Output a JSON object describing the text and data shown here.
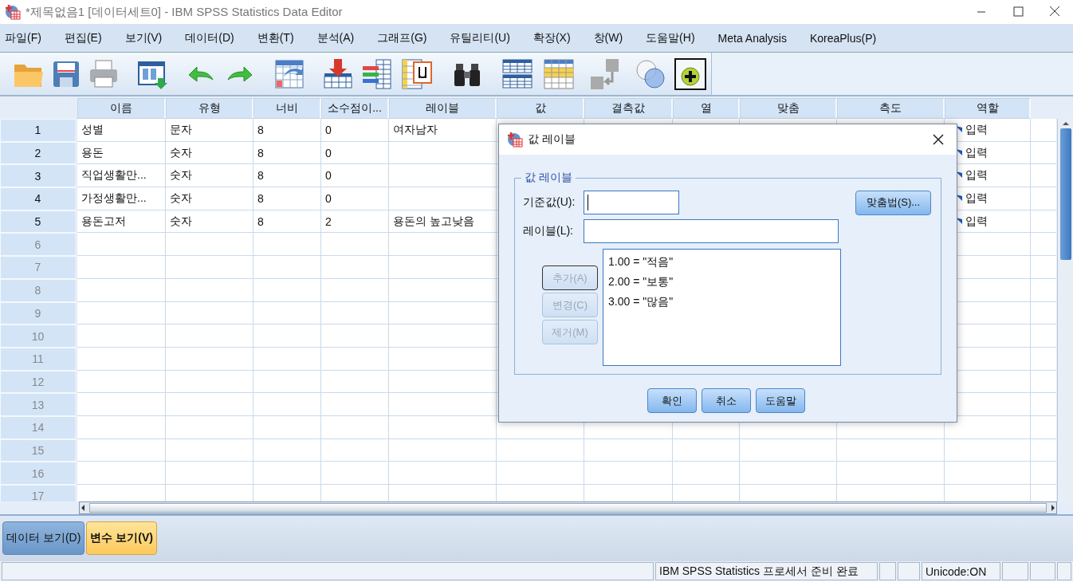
{
  "window": {
    "title": "*제목없음1 [데이터세트0] - IBM SPSS Statistics Data Editor"
  },
  "menu": [
    "파일(F)",
    "편집(E)",
    "보기(V)",
    "데이터(D)",
    "변환(T)",
    "분석(A)",
    "그래프(G)",
    "유틸리티(U)",
    "확장(X)",
    "창(W)",
    "도움말(H)",
    "Meta Analysis",
    "KoreaPlus(P)"
  ],
  "table": {
    "columns": [
      "이름",
      "유형",
      "너비",
      "소수점이...",
      "레이블",
      "값",
      "결측값",
      "열",
      "맞춤",
      "측도",
      "역할"
    ],
    "rows": [
      {
        "number": "1",
        "defined": true,
        "cells": [
          "성별",
          "문자",
          "8",
          "0",
          "여자남자"
        ],
        "role": "입력"
      },
      {
        "number": "2",
        "defined": true,
        "cells": [
          "용돈",
          "숫자",
          "8",
          "0"
        ],
        "role": "입력"
      },
      {
        "number": "3",
        "defined": true,
        "cells": [
          "직업생활만...",
          "숫자",
          "8",
          "0"
        ],
        "role": "입력"
      },
      {
        "number": "4",
        "defined": true,
        "cells": [
          "가정생활만...",
          "숫자",
          "8",
          "0"
        ],
        "role": "입력"
      },
      {
        "number": "5",
        "defined": true,
        "cells": [
          "용돈고저",
          "숫자",
          "8",
          "2",
          "용돈의 높고낮음"
        ],
        "role": "입력"
      },
      {
        "number": "6",
        "defined": false
      },
      {
        "number": "7",
        "defined": false
      },
      {
        "number": "8",
        "defined": false
      },
      {
        "number": "9",
        "defined": false
      },
      {
        "number": "10",
        "defined": false
      },
      {
        "number": "11",
        "defined": false
      },
      {
        "number": "12",
        "defined": false
      },
      {
        "number": "13",
        "defined": false
      },
      {
        "number": "14",
        "defined": false
      },
      {
        "number": "15",
        "defined": false
      },
      {
        "number": "16",
        "defined": false
      },
      {
        "number": "17",
        "defined": false
      }
    ]
  },
  "tabs": [
    {
      "label": "데이터 보기(D)",
      "selected": false
    },
    {
      "label": "변수 보기(V)",
      "selected": true
    }
  ],
  "status_bar": {
    "message": "IBM SPSS Statistics 프로세서 준비 완료",
    "encoding": "Unicode:ON"
  },
  "dialog": {
    "title": "값 레이블",
    "group": "값 레이블",
    "value_field": {
      "label": "기준값(U):",
      "focused": true
    },
    "label_field": {
      "label": "레이블(L):"
    },
    "side_buttons": [
      {
        "label": "추가(A)",
        "disabled": true,
        "focused": true
      },
      {
        "label": "변경(C)",
        "disabled": true,
        "focused": false
      },
      {
        "label": "제거(M)",
        "disabled": true,
        "focused": false
      }
    ],
    "list": [
      "1.00 = \"적음\"",
      "2.00 = \"보통\"",
      "3.00 = \"많음\""
    ],
    "spelling_button": "맞춤법(S)...",
    "buttons": [
      "확인",
      "취소",
      "도움말"
    ]
  }
}
